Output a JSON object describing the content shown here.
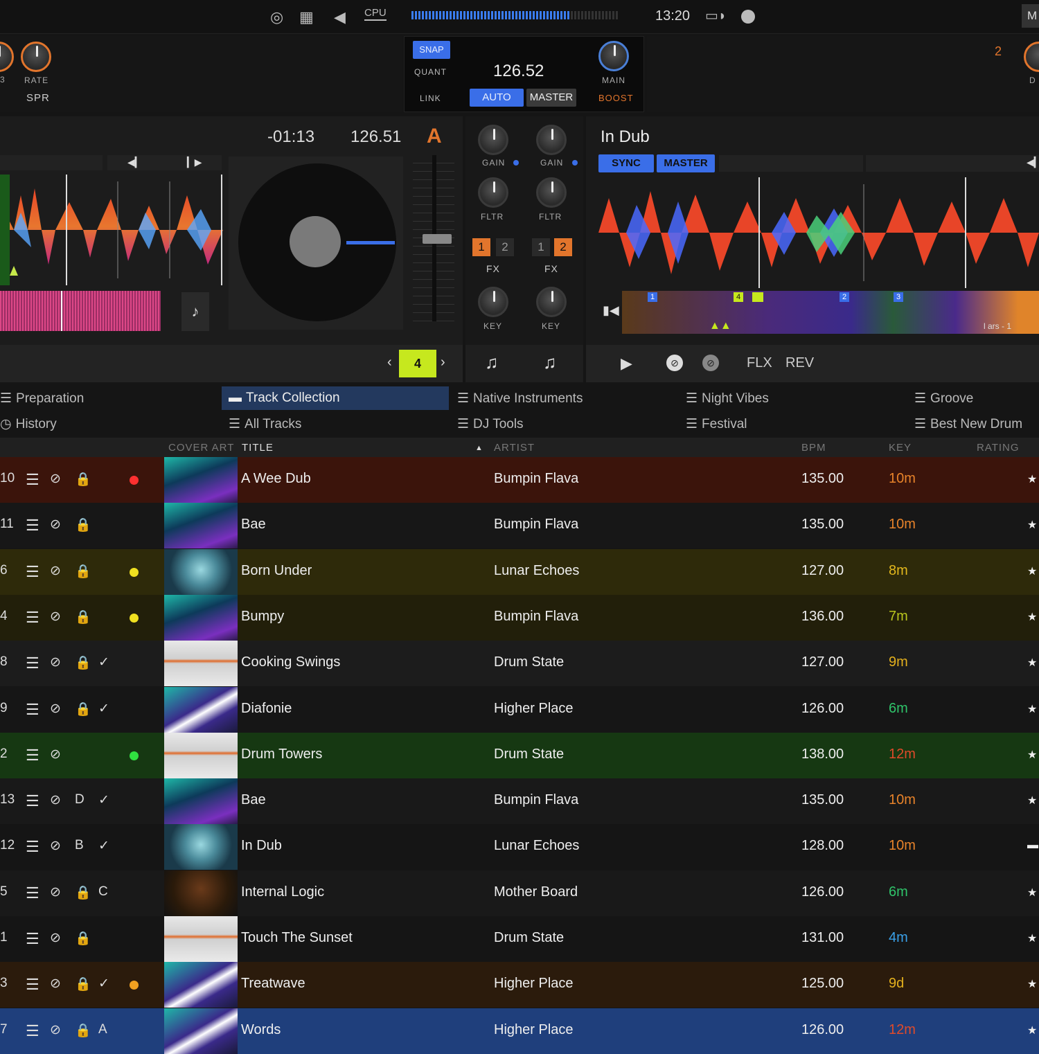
{
  "topbar": {
    "cpu_label": "CPU",
    "clock": "13:20",
    "right_label": "M"
  },
  "deck_left": {
    "rate_label": "RATE",
    "spr_label": "SPR",
    "edge_num": "3",
    "time_remaining": "-01:13",
    "bpm": "126.51",
    "deck_letter": "A",
    "loop_size": "4"
  },
  "master": {
    "snap": "SNAP",
    "quant": "QUANT",
    "link": "LINK",
    "tempo": "126.52",
    "main": "MAIN",
    "boost": "BOOST",
    "auto": "AUTO",
    "master": "MASTER"
  },
  "mixer": {
    "gain": "GAIN",
    "fltr": "FLTR",
    "fx": "FX",
    "key": "KEY",
    "fx1": "1",
    "fx2": "2"
  },
  "deck_right": {
    "title": "In Dub",
    "sync": "SYNC",
    "master": "MASTER",
    "flx": "FLX",
    "rev": "REV",
    "deck_num": "2",
    "right_label": "D",
    "cue_labels": [
      "1",
      "4",
      "2",
      "3"
    ],
    "bars_text": "l ars - 1"
  },
  "browser": {
    "nav": [
      {
        "label": "Preparation"
      },
      {
        "label": "History"
      },
      {
        "label": "Track Collection"
      },
      {
        "label": "All Tracks"
      },
      {
        "label": "Native Instruments"
      },
      {
        "label": "DJ Tools"
      },
      {
        "label": "Night Vibes"
      },
      {
        "label": "Festival"
      },
      {
        "label": "Groove"
      },
      {
        "label": "Best New Drum"
      }
    ],
    "columns": {
      "cover_art": "COVER ART",
      "title": "TITLE",
      "artist": "ARTIST",
      "bpm": "BPM",
      "key": "KEY",
      "rating": "RATING"
    }
  },
  "tracks": [
    {
      "num": "10",
      "lock": "🔒",
      "check": "",
      "color_dot": "#ff3030",
      "cover": "bumpin",
      "title": "A Wee Dub",
      "artist": "Bumpin Flava",
      "bpm": "135.00",
      "key": "10m",
      "key_color": "#e8832a",
      "row_bg": "#3b140b",
      "rating": "★"
    },
    {
      "num": "11",
      "lock": "🔒",
      "check": "",
      "color_dot": "",
      "cover": "bumpin",
      "title": "Bae",
      "artist": "Bumpin Flava",
      "bpm": "135.00",
      "key": "10m",
      "key_color": "#e8832a",
      "row_bg": "#171717",
      "rating": "★"
    },
    {
      "num": "6",
      "lock": "🔒",
      "check": "",
      "color_dot": "#f0e020",
      "cover": "lunar",
      "title": "Born Under",
      "artist": "Lunar Echoes",
      "bpm": "127.00",
      "key": "8m",
      "key_color": "#e3b81d",
      "row_bg": "#2e2a0a",
      "rating": "★"
    },
    {
      "num": "4",
      "lock": "🔒",
      "check": "",
      "color_dot": "#f0e020",
      "cover": "bumpin",
      "title": "Bumpy",
      "artist": "Bumpin Flava",
      "bpm": "136.00",
      "key": "7m",
      "key_color": "#b9c51d",
      "row_bg": "#221f0a",
      "rating": "★"
    },
    {
      "num": "8",
      "lock": "🔒",
      "check": "✓",
      "color_dot": "",
      "cover": "drumstate",
      "title": "Cooking Swings",
      "artist": "Drum State",
      "bpm": "127.00",
      "key": "9m",
      "key_color": "#e3b01d",
      "row_bg": "#1c1c1c",
      "rating": "★"
    },
    {
      "num": "9",
      "lock": "🔒",
      "check": "✓",
      "color_dot": "",
      "cover": "higher",
      "title": "Diafonie",
      "artist": "Higher Place",
      "bpm": "126.00",
      "key": "6m",
      "key_color": "#2fc46a",
      "row_bg": "#161616",
      "rating": "★"
    },
    {
      "num": "2",
      "lock": "",
      "check": "",
      "color_dot": "#30e040",
      "cover": "drumstate",
      "title": "Drum Towers",
      "artist": "Drum State",
      "bpm": "138.00",
      "key": "12m",
      "key_color": "#e04a2a",
      "row_bg": "#163812",
      "rating": "★"
    },
    {
      "num": "13",
      "lock": "D",
      "check": "✓",
      "color_dot": "",
      "cover": "bumpin",
      "title": "Bae",
      "artist": "Bumpin Flava",
      "bpm": "135.00",
      "key": "10m",
      "key_color": "#e8832a",
      "row_bg": "#191919",
      "rating": "★"
    },
    {
      "num": "12",
      "lock": "B",
      "check": "✓",
      "color_dot": "",
      "cover": "lunar",
      "title": "In Dub",
      "artist": "Lunar Echoes",
      "bpm": "128.00",
      "key": "10m",
      "key_color": "#e8832a",
      "row_bg": "#151515",
      "rating": "▬"
    },
    {
      "num": "5",
      "lock": "🔒",
      "check": "C",
      "color_dot": "",
      "cover": "mother",
      "title": "Internal Logic",
      "artist": "Mother Board",
      "bpm": "126.00",
      "key": "6m",
      "key_color": "#2fc46a",
      "row_bg": "#191919",
      "rating": "★"
    },
    {
      "num": "1",
      "lock": "🔒",
      "check": "",
      "color_dot": "",
      "cover": "drumstate",
      "title": "Touch The Sunset",
      "artist": "Drum State",
      "bpm": "131.00",
      "key": "4m",
      "key_color": "#3aa0e8",
      "row_bg": "#151515",
      "rating": "★"
    },
    {
      "num": "3",
      "lock": "🔒",
      "check": "✓",
      "color_dot": "#f0a020",
      "cover": "higher",
      "title": "Treatwave",
      "artist": "Higher Place",
      "bpm": "125.00",
      "key": "9d",
      "key_color": "#e3b01d",
      "row_bg": "#2b1b0c",
      "rating": "★"
    },
    {
      "num": "7",
      "lock": "🔒",
      "check": "A",
      "color_dot": "",
      "cover": "higher",
      "title": "Words",
      "artist": "Higher Place",
      "bpm": "126.00",
      "key": "12m",
      "key_color": "#e04a2a",
      "row_bg": "#1f3f7c",
      "rating": "★"
    }
  ]
}
